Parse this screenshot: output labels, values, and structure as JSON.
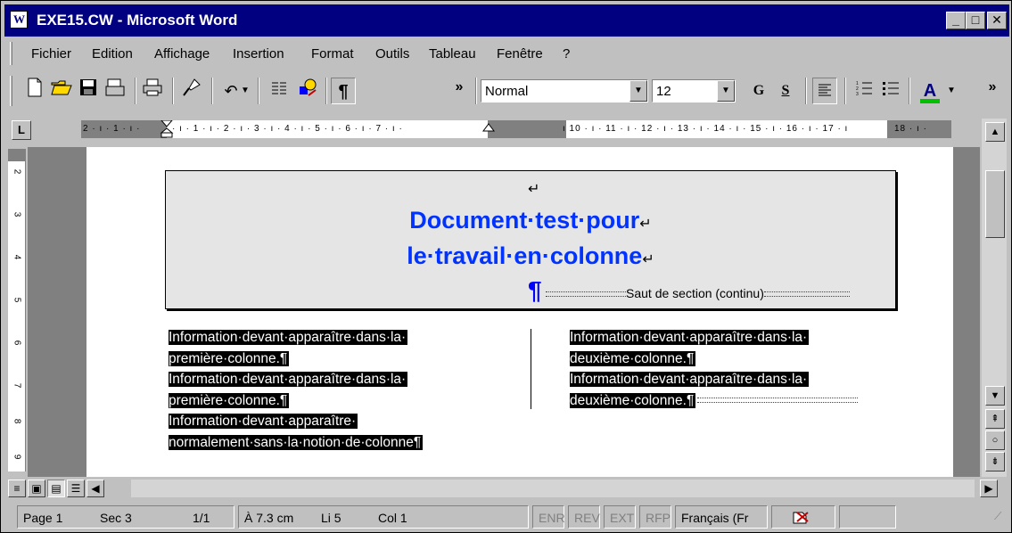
{
  "window": {
    "title": "EXE15.CW - Microsoft Word",
    "min_label": "_",
    "max_label": "□",
    "close_label": "✕"
  },
  "menu": [
    "Fichier",
    "Edition",
    "Affichage",
    "Insertion",
    "Format",
    "Outils",
    "Tableau",
    "Fenêtre",
    "?"
  ],
  "toolbar": {
    "style_value": "Normal",
    "size_value": "12",
    "bold_label": "G",
    "underline_label": "S",
    "font_color_label": "A",
    "more_label": "»",
    "more2_label": "»",
    "pilcrow_label": "¶",
    "font_color_swatch": "#00c000"
  },
  "ruler": {
    "tab_button": "L",
    "left_labels": "2 · ı · 1 · ı · ",
    "main_labels": "· ı · 1 · ı · 2 · ı · 3 · ı · 4 · ı · 5 · ı · 6 · ı · 7 · ı ·",
    "right_labels": "ı 10 · ı · 11 · ı · 12 · ı · 13 · ı · 14 · ı · 15 · ı · 16 · ı · 17 · ı",
    "far_label": "18 · ı ·",
    "vertical_labels": [
      "2",
      "3",
      "4",
      "5",
      "6",
      "7",
      "8",
      "9"
    ]
  },
  "document": {
    "header_return": "↵",
    "title_line1": "Document·test·pour",
    "title_line2": "le·travail·en·colonne",
    "line_return": "↵",
    "section_pilcrow": "¶",
    "section_break": "Saut de section (continu)",
    "col1": [
      "Information·devant·apparaître·dans·la·",
      "première·colonne.¶",
      "Information·devant·apparaître·dans·la·",
      "première·colonne.¶",
      "Information·devant·apparaître·",
      "normalement·sans·la·notion·de·colonne¶"
    ],
    "col2": [
      "Information·devant·apparaître·dans·la·",
      "deuxième·colonne.¶",
      "Information·devant·apparaître·dans·la·",
      "deuxième·colonne.¶"
    ]
  },
  "statusbar": {
    "page": "Page 1",
    "sec": "Sec 3",
    "pages": "1/1",
    "at": "À 7.3 cm",
    "line": "Li 5",
    "col": "Col 1",
    "enr": "ENR",
    "rev": "REV",
    "ext": "EXT",
    "rfp": "RFP",
    "lang": "Français (Fr"
  }
}
